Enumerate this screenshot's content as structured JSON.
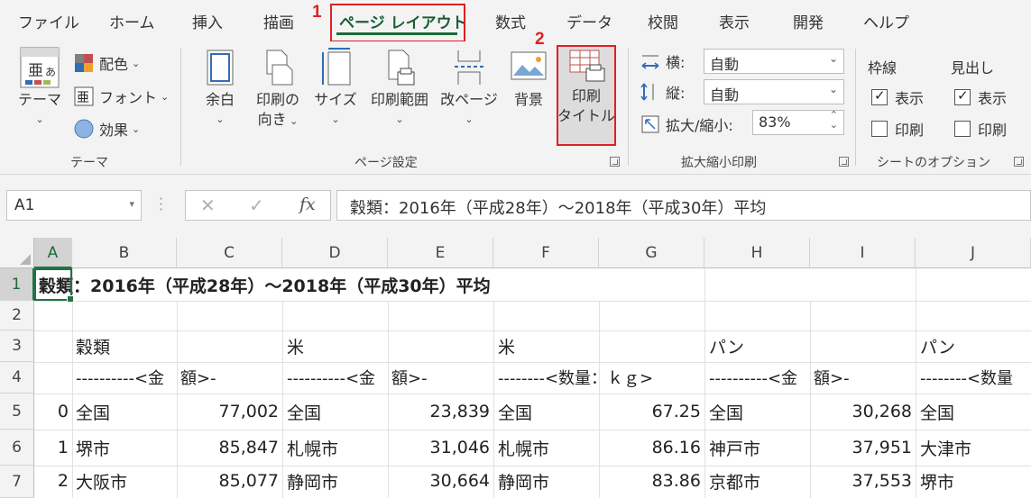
{
  "tabs": [
    "ファイル",
    "ホーム",
    "挿入",
    "描画",
    "ページ レイアウト",
    "数式",
    "データ",
    "校閲",
    "表示",
    "開発",
    "ヘルプ"
  ],
  "markers": {
    "one": "1",
    "two": "2"
  },
  "ribbon": {
    "themes": {
      "theme_label": "テーマ",
      "colors": "配色",
      "fonts": "フォント",
      "effects": "効果",
      "group": "テーマ"
    },
    "page_setup": {
      "margins": "余白",
      "orientation": [
        "印刷の",
        "向き"
      ],
      "size": "サイズ",
      "print_area": "印刷範囲",
      "breaks": "改ページ",
      "background": "背景",
      "print_titles": [
        "印刷",
        "タイトル"
      ],
      "group": "ページ設定"
    },
    "scale": {
      "width_label": "横:",
      "width_value": "自動",
      "height_label": "縦:",
      "height_value": "自動",
      "scale_label": "拡大/縮小:",
      "scale_value": "83%",
      "group": "拡大縮小印刷"
    },
    "sheet_options": {
      "gridlines": "枠線",
      "headings": "見出し",
      "view": "表示",
      "print": "印刷",
      "group": "シートのオプション"
    }
  },
  "formula_bar": {
    "name_box": "A1",
    "cancel": "✕",
    "enter": "✓",
    "fx": "fx",
    "content": "穀類：2016年（平成28年）〜2018年（平成30年）平均"
  },
  "grid": {
    "columns": [
      "A",
      "B",
      "C",
      "D",
      "E",
      "F",
      "G",
      "H",
      "I",
      "J"
    ],
    "rows": [
      "1",
      "2",
      "3",
      "4",
      "5",
      "6",
      "7"
    ],
    "title": "穀類：2016年（平成28年）〜2018年（平成30年）平均",
    "row3": {
      "b": "穀類",
      "d": "米",
      "f": "米",
      "h": "パン",
      "j": "パン"
    },
    "row4": {
      "bc": "----------<金　額>-",
      "de": "----------<金　額>-",
      "fg": "--------<数量：ｋｇ>",
      "hi": "----------<金　額>-",
      "j": "--------<数量"
    },
    "data": [
      {
        "a": "0",
        "b": "全国",
        "c": "77,002",
        "d": "全国",
        "e": "23,839",
        "f": "全国",
        "g": "67.25",
        "h": "全国",
        "i": "30,268",
        "j": "全国"
      },
      {
        "a": "1",
        "b": "堺市",
        "c": "85,847",
        "d": "札幌市",
        "e": "31,046",
        "f": "札幌市",
        "g": "86.16",
        "h": "神戸市",
        "i": "37,951",
        "j": "大津市"
      },
      {
        "a": "2",
        "b": "大阪市",
        "c": "85,077",
        "d": "静岡市",
        "e": "30,664",
        "f": "静岡市",
        "g": "83.86",
        "h": "京都市",
        "i": "37,553",
        "j": "堺市"
      }
    ]
  },
  "colors": {
    "accent": "#217346",
    "highlight": "#e02020"
  }
}
